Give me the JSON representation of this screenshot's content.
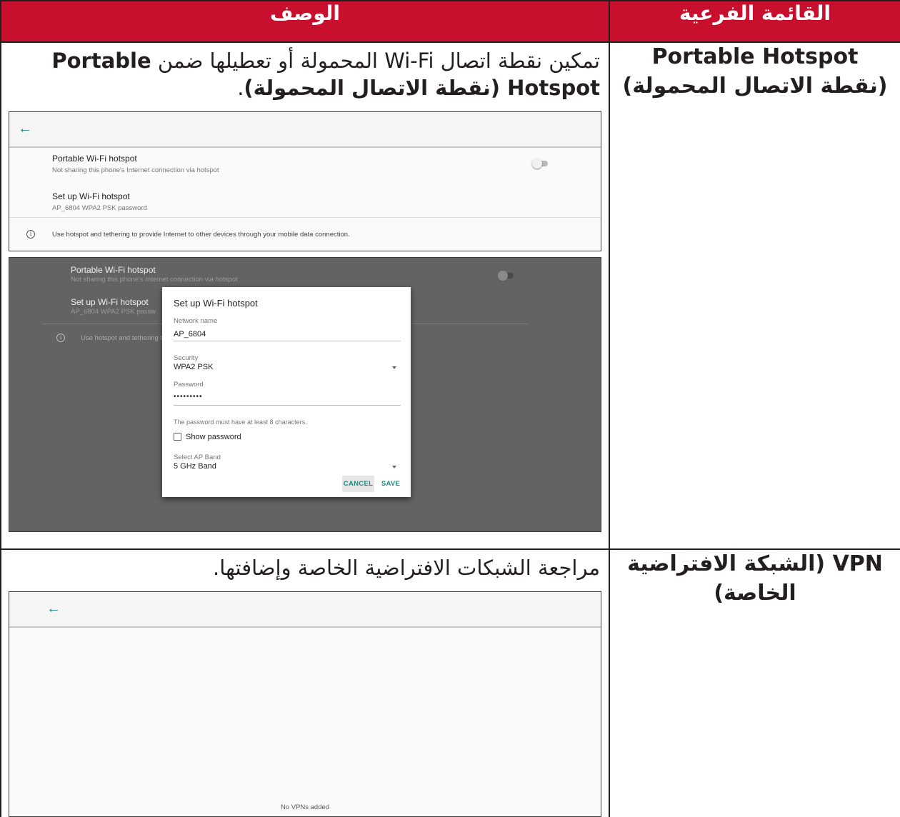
{
  "header": {
    "col_description": "الوصف",
    "col_submenu": "القائمة الفرعية"
  },
  "rows": [
    {
      "submenu_label": "Portable Hotspot (نقطة الاتصال المحمولة)",
      "description_plain": "تمكين نقطة اتصال Wi-Fi المحمولة أو تعطيلها ضمن ",
      "description_bold": "Portable Hotspot (نقطة الاتصال المحمولة)",
      "description_end": ".",
      "screenshot_settings": {
        "back_icon": "arrow-left-icon",
        "item1_title": "Portable Wi-Fi hotspot",
        "item1_subtitle": "Not sharing this phone's Internet connection via hotspot",
        "item1_toggle_on": false,
        "item2_title": "Set up Wi-Fi hotspot",
        "item2_subtitle": "AP_6804 WPA2 PSK password",
        "info_icon": "info-icon",
        "info_text": "Use hotspot and tethering to provide Internet to other devices through your mobile data connection."
      },
      "screenshot_dialog": {
        "bg_item1_title": "Portable Wi-Fi hotspot",
        "bg_item1_subtitle": "Not sharing this phone's Internet connection via hotspot",
        "bg_item2_title": "Set up Wi-Fi hotspot",
        "bg_item2_subtitle": "AP_6804 WPA2 PSK passw",
        "bg_info_text": "Use hotspot and tethering to",
        "dialog_title": "Set up Wi-Fi hotspot",
        "network_label": "Network name",
        "network_value": "AP_6804",
        "security_label": "Security",
        "security_value": "WPA2 PSK",
        "password_label": "Password",
        "password_value": "•••••••••",
        "password_hint": "The password must have at least 8 characters.",
        "show_password_label": "Show password",
        "show_password_checked": false,
        "band_label": "Select AP Band",
        "band_value": "5 GHz Band",
        "cancel_label": "CANCEL",
        "save_label": "SAVE"
      }
    },
    {
      "submenu_label": "VPN (الشبكة الافتراضية الخاصة)",
      "description": "مراجعة الشبكات الافتراضية الخاصة وإضافتها.",
      "screenshot_vpn": {
        "back_icon": "arrow-left-icon",
        "empty_message": "No VPNs added"
      }
    }
  ],
  "colors": {
    "header_bg": "#c8102e",
    "accent": "#1f8b7e"
  }
}
